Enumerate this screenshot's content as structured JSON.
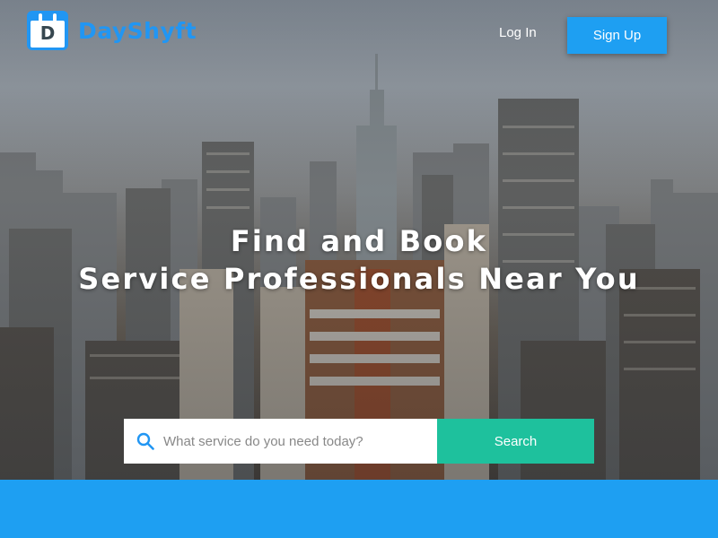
{
  "brand": {
    "name": "DayShyft",
    "logo_letter": "D",
    "color": "#2196f3"
  },
  "header": {
    "login_label": "Log In",
    "signup_label": "Sign Up"
  },
  "hero": {
    "headline_line1": "Find and Book",
    "headline_line2": "Service Professionals Near You",
    "background": "city skyline photo"
  },
  "search": {
    "placeholder": "What service do you need today?",
    "value": "",
    "button_label": "Search",
    "button_color": "#1ec19d",
    "icon": "search-icon"
  },
  "colors": {
    "accent": "#1e9ff2",
    "search_button": "#1ec19d"
  }
}
